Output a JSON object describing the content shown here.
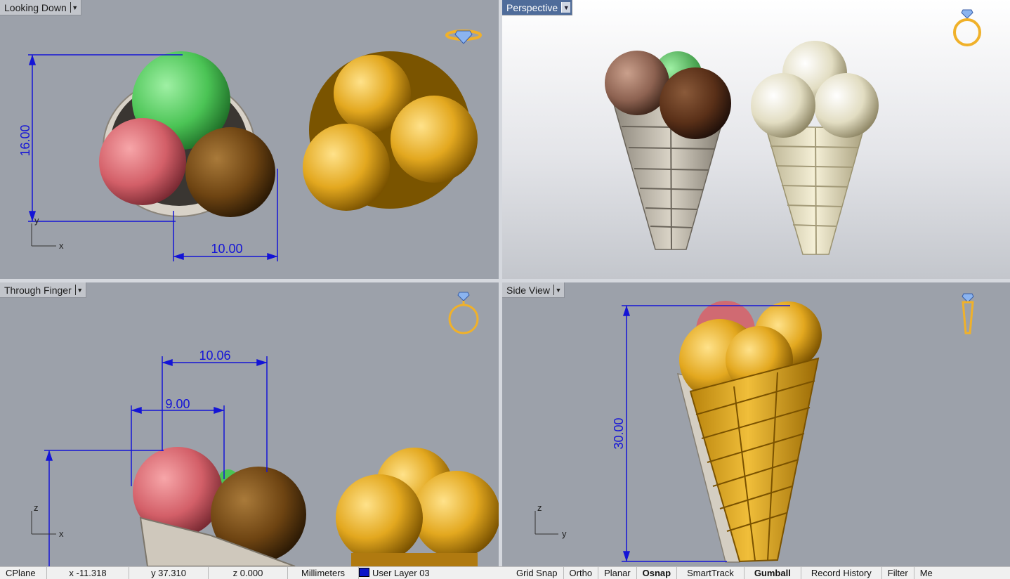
{
  "viewports": {
    "top_left": {
      "name": "Looking Down",
      "dims": [
        "16.00",
        "10.00"
      ],
      "axes": [
        "y",
        "x"
      ]
    },
    "top_right": {
      "name": "Perspective"
    },
    "bottom_left": {
      "name": "Through Finger",
      "dims": [
        "10.06",
        "9.00"
      ],
      "axes": [
        "z",
        "x"
      ]
    },
    "bottom_right": {
      "name": "Side View",
      "dims": [
        "30.00"
      ],
      "axes": [
        "z",
        "y"
      ]
    }
  },
  "statusbar": {
    "cplane": "CPlane",
    "x": "x -11.318",
    "y": "y 37.310",
    "z": "z 0.000",
    "units": "Millimeters",
    "layer": "User Layer 03",
    "layer_color": "#0a16c8",
    "toggles": [
      "Grid Snap",
      "Ortho",
      "Planar",
      "Osnap",
      "SmartTrack",
      "Gumball",
      "Record History",
      "Filter",
      "Me"
    ]
  },
  "colors": {
    "gold": "#e3a81f",
    "silver": "#e2ddc2",
    "dimension": "#1414d6",
    "viewport_bg": "#9ca1aa"
  },
  "icons": [
    "ring-gem-icon",
    "ring-front-icon",
    "ring-side-icon"
  ]
}
